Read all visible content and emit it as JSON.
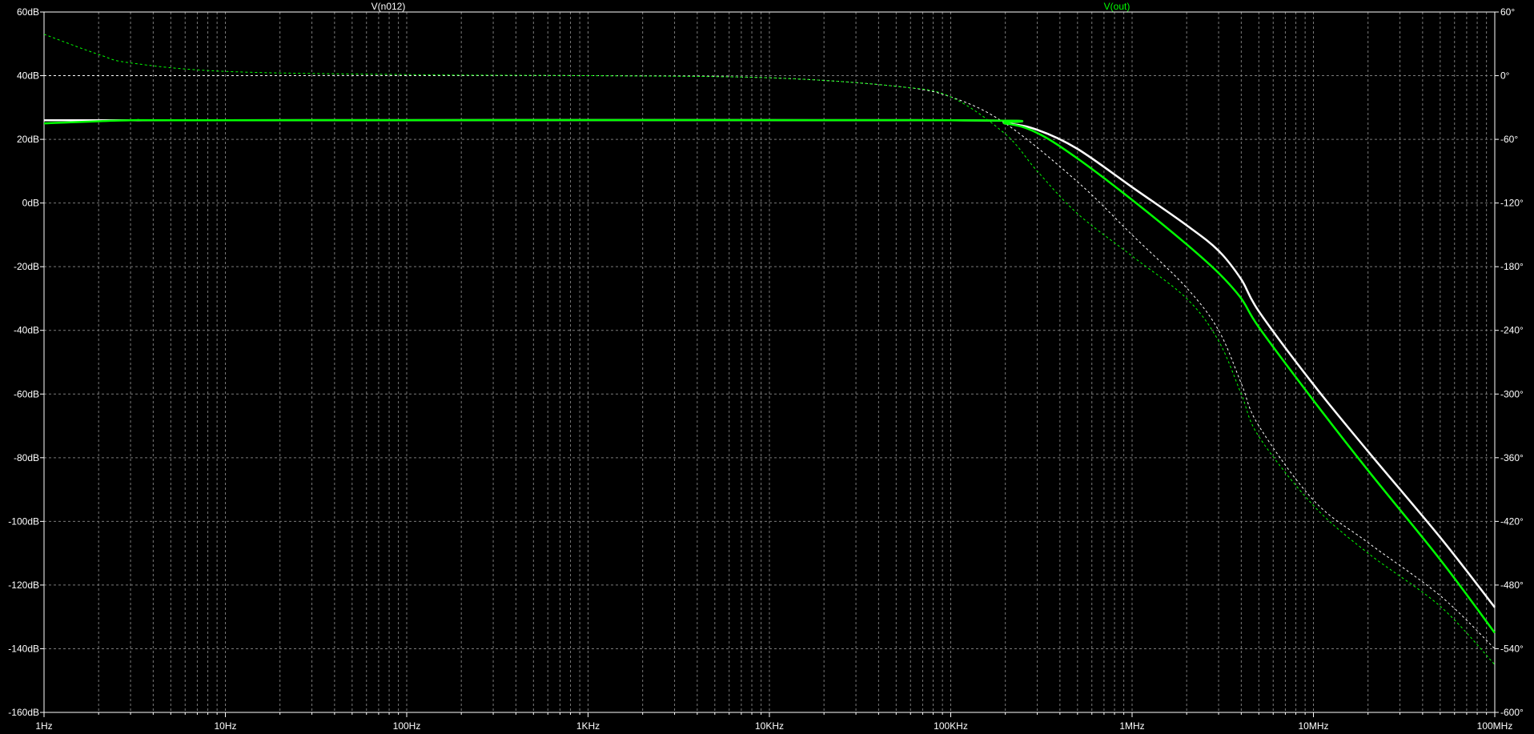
{
  "chart_data": {
    "type": "line",
    "x_scale": "log",
    "xlim_hz": [
      1,
      100000000
    ],
    "y_left_lim_db": [
      -160,
      60
    ],
    "y_right_lim_deg": [
      -600,
      60
    ],
    "grid": true,
    "x_ticks": [
      {
        "value": 1,
        "label": "1Hz"
      },
      {
        "value": 10,
        "label": "10Hz"
      },
      {
        "value": 100,
        "label": "100Hz"
      },
      {
        "value": 1000,
        "label": "1KHz"
      },
      {
        "value": 10000,
        "label": "10KHz"
      },
      {
        "value": 100000,
        "label": "100KHz"
      },
      {
        "value": 1000000,
        "label": "1MHz"
      },
      {
        "value": 10000000,
        "label": "10MHz"
      },
      {
        "value": 100000000,
        "label": "100MHz"
      }
    ],
    "y_left_ticks": [
      {
        "value": 60,
        "label": "60dB"
      },
      {
        "value": 40,
        "label": "40dB"
      },
      {
        "value": 20,
        "label": "20dB"
      },
      {
        "value": 0,
        "label": "0dB"
      },
      {
        "value": -20,
        "label": "-20dB"
      },
      {
        "value": -40,
        "label": "-40dB"
      },
      {
        "value": -60,
        "label": "-60dB"
      },
      {
        "value": -80,
        "label": "-80dB"
      },
      {
        "value": -100,
        "label": "-100dB"
      },
      {
        "value": -120,
        "label": "-120dB"
      },
      {
        "value": -140,
        "label": "-140dB"
      },
      {
        "value": -160,
        "label": "-160dB"
      }
    ],
    "y_right_ticks": [
      {
        "value": 60,
        "label": "60°"
      },
      {
        "value": 0,
        "label": "0°"
      },
      {
        "value": -60,
        "label": "-60°"
      },
      {
        "value": -120,
        "label": "-120°"
      },
      {
        "value": -180,
        "label": "-180°"
      },
      {
        "value": -240,
        "label": "-240°"
      },
      {
        "value": -300,
        "label": "-300°"
      },
      {
        "value": -360,
        "label": "-360°"
      },
      {
        "value": -420,
        "label": "-420°"
      },
      {
        "value": -480,
        "label": "-480°"
      },
      {
        "value": -540,
        "label": "-540°"
      },
      {
        "value": -600,
        "label": "-600°"
      }
    ],
    "series": [
      {
        "name": "V(n012)",
        "color": "#ffffff",
        "magnitude_db": [
          [
            1,
            26
          ],
          [
            10,
            26
          ],
          [
            100000,
            26
          ],
          [
            200000,
            25
          ],
          [
            300000,
            23
          ],
          [
            500000,
            17
          ],
          [
            1000000,
            5
          ],
          [
            2000000,
            -7
          ],
          [
            3000000,
            -15
          ],
          [
            4000000,
            -24
          ],
          [
            5000000,
            -34
          ],
          [
            10000000,
            -57
          ],
          [
            20000000,
            -78
          ],
          [
            50000000,
            -105
          ],
          [
            100000000,
            -127
          ]
        ],
        "phase_deg": [
          [
            1,
            0
          ],
          [
            10,
            0
          ],
          [
            1000,
            0
          ],
          [
            10000,
            -2
          ],
          [
            50000,
            -10
          ],
          [
            100000,
            -20
          ],
          [
            200000,
            -45
          ],
          [
            500000,
            -100
          ],
          [
            1000000,
            -150
          ],
          [
            2000000,
            -200
          ],
          [
            3000000,
            -240
          ],
          [
            4000000,
            -290
          ],
          [
            5000000,
            -330
          ],
          [
            10000000,
            -400
          ],
          [
            20000000,
            -440
          ],
          [
            50000000,
            -490
          ],
          [
            100000000,
            -540
          ]
        ]
      },
      {
        "name": "V(out)",
        "color": "#00ff00",
        "magnitude_db": [
          [
            1,
            25
          ],
          [
            3,
            26
          ],
          [
            10,
            26
          ],
          [
            100000,
            26
          ],
          [
            200000,
            25
          ],
          [
            300000,
            22
          ],
          [
            500000,
            14
          ],
          [
            1000000,
            1
          ],
          [
            2000000,
            -13
          ],
          [
            3000000,
            -22
          ],
          [
            4000000,
            -30
          ],
          [
            5000000,
            -39
          ],
          [
            10000000,
            -62
          ],
          [
            20000000,
            -84
          ],
          [
            50000000,
            -112
          ],
          [
            100000000,
            -135
          ]
        ],
        "phase_deg": [
          [
            1,
            39
          ],
          [
            2,
            20
          ],
          [
            3,
            12
          ],
          [
            10,
            4
          ],
          [
            100,
            1
          ],
          [
            1000,
            0
          ],
          [
            10000,
            -2
          ],
          [
            50000,
            -10
          ],
          [
            100000,
            -20
          ],
          [
            200000,
            -55
          ],
          [
            300000,
            -90
          ],
          [
            500000,
            -130
          ],
          [
            1000000,
            -170
          ],
          [
            2000000,
            -210
          ],
          [
            3000000,
            -250
          ],
          [
            4000000,
            -300
          ],
          [
            5000000,
            -340
          ],
          [
            10000000,
            -405
          ],
          [
            20000000,
            -450
          ],
          [
            50000000,
            -500
          ],
          [
            100000000,
            -555
          ]
        ]
      }
    ]
  }
}
